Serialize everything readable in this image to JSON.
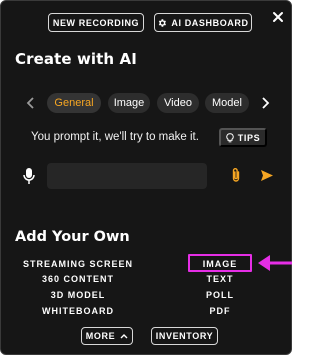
{
  "header": {
    "new_recording_label": "NEW RECORDING",
    "ai_dashboard_label": "AI DASHBOARD",
    "ai_dashboard_icon": "gear-icon",
    "close_icon": "close-icon"
  },
  "create": {
    "title": "Create with AI",
    "tabs": [
      {
        "label": "General",
        "active": true
      },
      {
        "label": "Image",
        "active": false
      },
      {
        "label": "Video",
        "active": false
      },
      {
        "label": "Model",
        "active": false
      }
    ],
    "prompt_text": "You prompt it, we'll try to make it.",
    "tips_label": "TIPS",
    "tips_icon": "lightbulb-icon",
    "input_value": "",
    "mic_icon": "microphone-icon",
    "attach_icon": "paperclip-icon",
    "send_icon": "send-icon"
  },
  "own": {
    "title": "Add Your Own",
    "left": [
      "STREAMING SCREEN",
      "360 CONTENT",
      "3D MODEL",
      "WHITEBOARD"
    ],
    "right": [
      "IMAGE",
      "TEXT",
      "POLL",
      "PDF"
    ],
    "highlighted": "IMAGE"
  },
  "footer": {
    "more_label": "MORE",
    "more_icon": "chevron-up-icon",
    "inventory_label": "INVENTORY"
  },
  "colors": {
    "panel_bg": "#161616",
    "accent": "#f6a623",
    "highlight": "#e62ee6"
  }
}
